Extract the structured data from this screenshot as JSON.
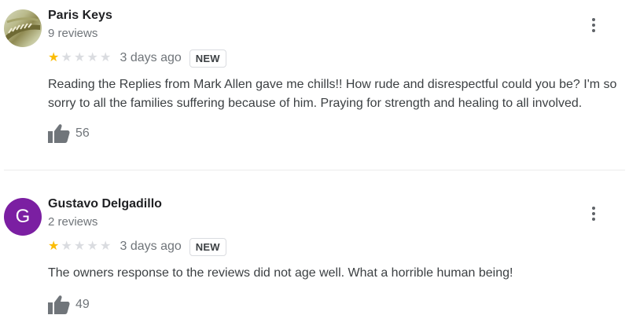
{
  "reviews": [
    {
      "reviewer_name": "Paris Keys",
      "review_count": "9 reviews",
      "rating": 1,
      "max_rating": 5,
      "date": "3 days ago",
      "badge": "NEW",
      "text": "Reading the Replies from Mark Allen gave me chills!! How rude and disrespectful could you be? I'm so sorry to all the families suffering because of him. Praying for strength and healing to all involved.",
      "likes": "56",
      "avatar": "photo"
    },
    {
      "reviewer_name": "Gustavo Delgadillo",
      "review_count": "2 reviews",
      "rating": 1,
      "max_rating": 5,
      "date": "3 days ago",
      "badge": "NEW",
      "text": "The owners response to the reviews did not age well. What a horrible human being!",
      "likes": "49",
      "avatar": "letter",
      "avatar_letter": "G",
      "avatar_color": "#7b1fa2"
    }
  ],
  "colors": {
    "star_filled": "#fbbc04",
    "star_empty": "#dadce0",
    "secondary_text": "#70757a"
  },
  "icons": {
    "menu": "more-vert-icon",
    "like": "thumbs-up-icon",
    "star": "star-icon"
  }
}
